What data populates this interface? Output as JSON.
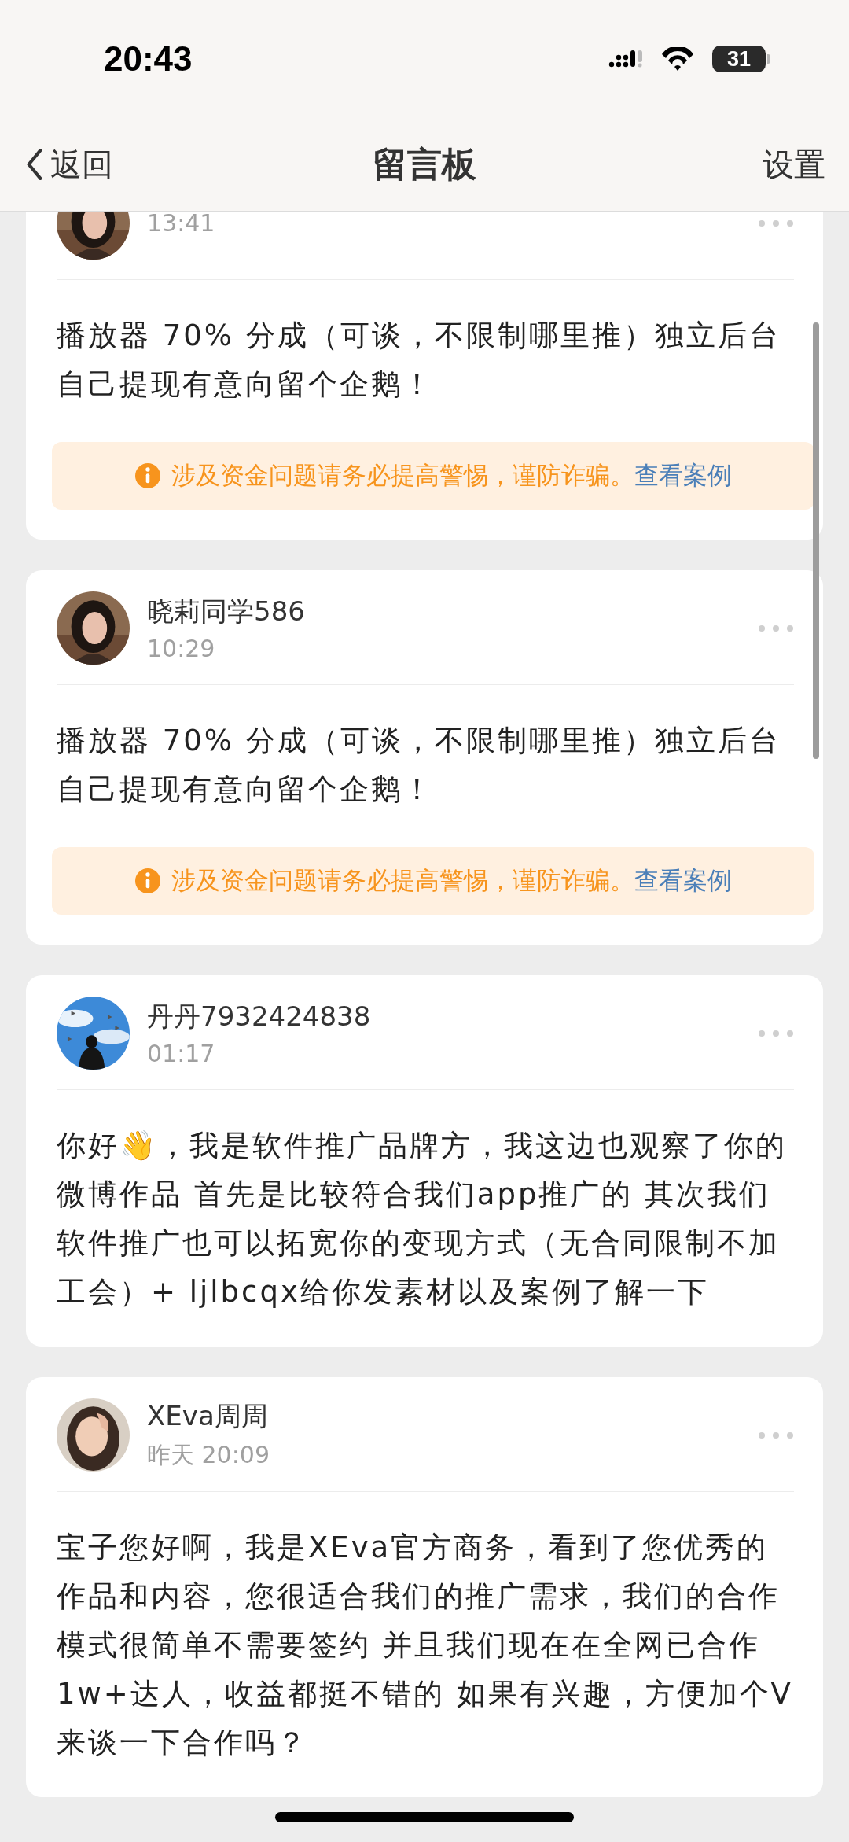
{
  "status_bar": {
    "time": "20:43",
    "battery": "31"
  },
  "nav": {
    "back": "返回",
    "title": "留言板",
    "action": "设置"
  },
  "messages": [
    {
      "time": "13:41",
      "body": "播放器 70% 分成（可谈，不限制哪里推）独立后台自己提现有意向留个企鹅！",
      "warning": {
        "text": "涉及资金问题请务必提高警惕，谨防诈骗。",
        "link": "查看案例"
      }
    },
    {
      "author": "晓莉同学586",
      "time": "10:29",
      "body": "播放器 70% 分成（可谈，不限制哪里推）独立后台自己提现有意向留个企鹅！",
      "warning": {
        "text": "涉及资金问题请务必提高警惕，谨防诈骗。",
        "link": "查看案例"
      }
    },
    {
      "author": "丹丹7932424838",
      "time": "01:17",
      "body": "你好👋，我是软件推广品牌方，我这边也观察了你的微博作品 首先是比较符合我们app推广的 其次我们软件推广也可以拓宽你的变现方式（无合同限制不加工会）+  ljlbcqx给你发素材以及案例了解一下"
    },
    {
      "author": "XEva周周",
      "time": "昨天 20:09",
      "body": "宝子您好啊，我是XEva官方商务，看到了您优秀的作品和内容，您很适合我们的推广需求，我们的合作模式很简单不需要签约 并且我们现在在全网已合作1w+达人，收益都挺不错的 如果有兴趣，方便加个V来谈一下合作吗？"
    }
  ]
}
